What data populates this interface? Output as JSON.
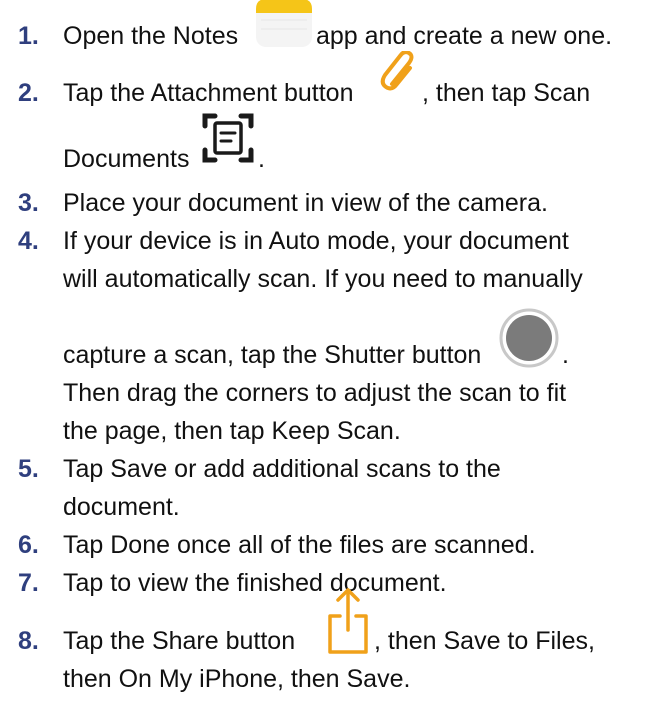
{
  "steps": [
    {
      "num": "1.",
      "lines": [
        "Open the Notes",
        "app and create a new one."
      ]
    },
    {
      "num": "2.",
      "lines": [
        "Tap the Attachment button",
        ", then tap Scan",
        "Documents",
        "."
      ]
    },
    {
      "num": "3.",
      "lines": [
        "Place your document in view of the camera."
      ]
    },
    {
      "num": "4.",
      "lines": [
        "If your device is in Auto mode, your document",
        "will automatically scan. If you need to manually",
        "capture a scan, tap the Shutter button",
        ".",
        "Then drag the corners to adjust the scan to fit",
        "the page, then tap Keep Scan."
      ]
    },
    {
      "num": "5.",
      "lines": [
        "Tap Save or add additional scans to the",
        "document."
      ]
    },
    {
      "num": "6.",
      "lines": [
        "Tap Done once all of the files are scanned."
      ]
    },
    {
      "num": "7.",
      "lines": [
        "Tap to view the finished document."
      ]
    },
    {
      "num": "8.",
      "lines": [
        "Tap the Share button",
        ", then Save to Files,",
        "then On My iPhone, then Save."
      ]
    }
  ],
  "icons": {
    "notes": "notes-app-icon",
    "attachment": "paperclip-icon",
    "scan": "scan-documents-icon",
    "shutter": "shutter-button-icon",
    "share": "share-icon"
  },
  "colors": {
    "step_number": "#2f3f7e",
    "accent_yellow": "#f5c518",
    "attachment_orange": "#f0a11a",
    "share_orange": "#f0a11a"
  }
}
